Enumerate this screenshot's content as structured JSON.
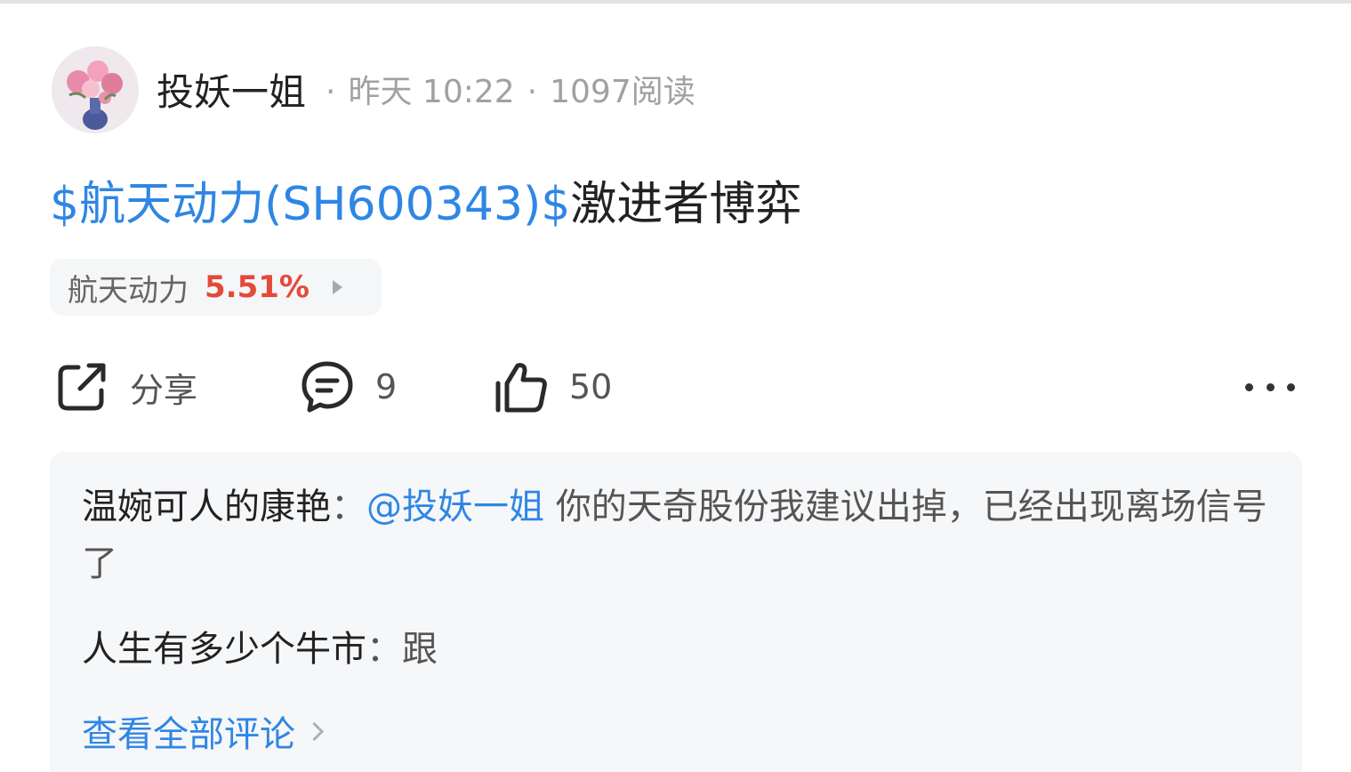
{
  "post": {
    "author": "投妖一姐",
    "time": "昨天 10:22",
    "reads": "1097阅读",
    "separator": "·",
    "stock_tag": "$航天动力(SH600343)$",
    "body_text": "激进者博弈"
  },
  "stock_chip": {
    "name": "航天动力",
    "change": "5.51%",
    "change_color": "#e4493a"
  },
  "actions": {
    "share_label": "分享",
    "comment_count": "9",
    "like_count": "50",
    "share_icon": "share-icon",
    "comment_icon": "comment-bubble-icon",
    "like_icon": "thumbs-up-icon",
    "more_icon": "more-dots-icon"
  },
  "comments": [
    {
      "user": "温婉可人的康艳",
      "colon": "：",
      "mention": "@投妖一姐",
      "text": " 你的天奇股份我建议出掉，已经出现离场信号了"
    },
    {
      "user": "人生有多少个牛市",
      "colon": "：",
      "text": "跟"
    }
  ],
  "view_all_label": "查看全部评论",
  "colors": {
    "link_blue": "#2f86e4",
    "meta_gray": "#a1a1a1",
    "comment_bg": "#f6f7f9"
  }
}
